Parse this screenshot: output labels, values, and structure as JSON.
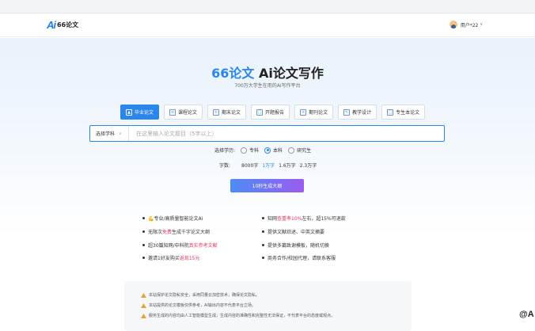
{
  "header": {
    "logo_mark": "Ai",
    "logo_text": "66论文",
    "user_name": "用户*22",
    "user_chevron": "∨"
  },
  "hero": {
    "title_brand": "66论文",
    "title_rest": " Ai论文写作",
    "subtitle": "700万大学生在用的AI写作平台"
  },
  "tabs": [
    {
      "label": "毕业论文",
      "icon": "graduation-cap-icon",
      "active": true
    },
    {
      "label": "课程论文",
      "icon": "book-icon",
      "active": false
    },
    {
      "label": "期末论文",
      "icon": "document-icon",
      "active": false
    },
    {
      "label": "开题报告",
      "icon": "report-icon",
      "active": false
    },
    {
      "label": "期刊论文",
      "icon": "journal-icon",
      "active": false
    },
    {
      "label": "教学设计",
      "icon": "teaching-icon",
      "active": false
    },
    {
      "label": "专生本论文",
      "icon": "paper-icon",
      "active": false
    }
  ],
  "search": {
    "subject_label": "选择学科",
    "subject_chevron": "∨",
    "placeholder": "在这里输入论文题目（5字以上）"
  },
  "degree": {
    "label": "选择学历:",
    "options": [
      "专科",
      "本科",
      "研究生"
    ],
    "selected": "本科"
  },
  "word_count": {
    "label": "字数:",
    "options": [
      "8000字",
      "1万字",
      "1.6万字",
      "2.3万字"
    ],
    "selected": "1万字"
  },
  "generate_button": "10秒生成大纲",
  "features": {
    "left": [
      {
        "pre": "💪专业/高质量智能论文Ai",
        "hl": "",
        "post": ""
      },
      {
        "pre": "无限次",
        "hl": "免费",
        "post": "生成千字论文大纲"
      },
      {
        "pre": "超30篇知网/中科院",
        "hl": "真实参考文献",
        "post": ""
      },
      {
        "pre": "邀请1好友购买",
        "hl": "返现15元",
        "post": ""
      }
    ],
    "right": [
      {
        "pre": "知网",
        "hl": "查重率10%",
        "post": "左右，超15%可退款"
      },
      {
        "pre": "提供文献综述、中英文摘要",
        "hl": "",
        "post": ""
      },
      {
        "pre": "提供多篇致谢模板，随机切换",
        "hl": "",
        "post": ""
      },
      {
        "pre": "商务合作/校园代理，请联系客服",
        "hl": "",
        "post": ""
      }
    ]
  },
  "notices": [
    "本站保护论文隐私安全，采用同量云加密技术，确保论文隐私。",
    "本站提供的论文模板仅供参考，AI输出内容不代表平台立场。",
    "服务生成的内容均由人工智能模型生成，生成内容的准确性和完整性无法保证，不代表平台的态度或观点。"
  ],
  "watermark": "@A",
  "colors": {
    "accent": "#2a86ea",
    "highlight": "#e53961",
    "button_gradient_start": "#4c8cf5",
    "button_gradient_end": "#9a5cf0"
  }
}
